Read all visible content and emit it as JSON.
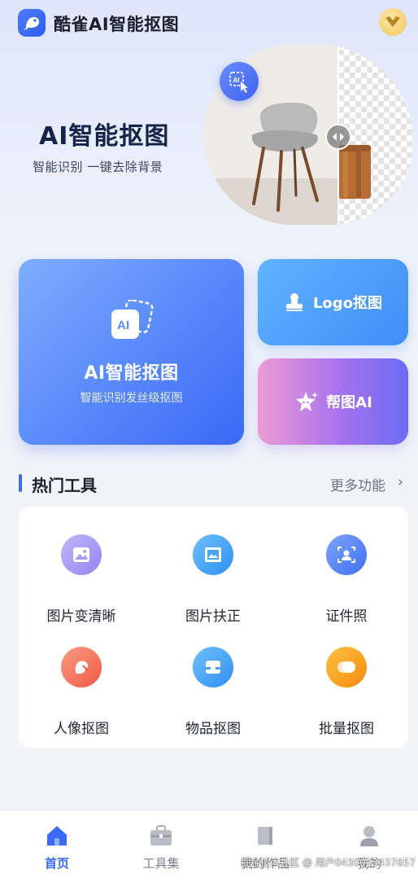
{
  "header": {
    "app_title": "酷雀AI智能抠图"
  },
  "hero": {
    "title": "AI智能抠图",
    "subtitle": "智能识别  一键去除背景"
  },
  "cards": {
    "main": {
      "title": "AI智能抠图",
      "subtitle": "智能识别发丝级抠图"
    },
    "logo": {
      "label": "Logo抠图"
    },
    "helper": {
      "label": "帮图AI"
    }
  },
  "section": {
    "title": "热门工具",
    "more_label": "更多功能",
    "more_chevron": "›"
  },
  "tools": [
    {
      "label": "图片变清晰",
      "icon": "image-enhance-icon",
      "color": "#a79bf5"
    },
    {
      "label": "图片扶正",
      "icon": "image-straighten-icon",
      "color": "#4aa6f5"
    },
    {
      "label": "证件照",
      "icon": "id-photo-icon",
      "color": "#5b8cf6"
    },
    {
      "label": "人像抠图",
      "icon": "portrait-cutout-icon",
      "color": "#f47a63"
    },
    {
      "label": "物品抠图",
      "icon": "object-cutout-icon",
      "color": "#4aa6f5"
    },
    {
      "label": "批量抠图",
      "icon": "batch-cutout-icon",
      "color": "#f7a51c"
    }
  ],
  "nav": [
    {
      "label": "首页",
      "active": true
    },
    {
      "label": "工具集",
      "active": false
    },
    {
      "label": "我的作品",
      "active": false
    },
    {
      "label": "我的",
      "active": false
    }
  ],
  "watermark": "掘金技术社区 @ 用户0430003437657",
  "colors": {
    "accent": "#3a6af6",
    "background": "#f2f4f8"
  }
}
